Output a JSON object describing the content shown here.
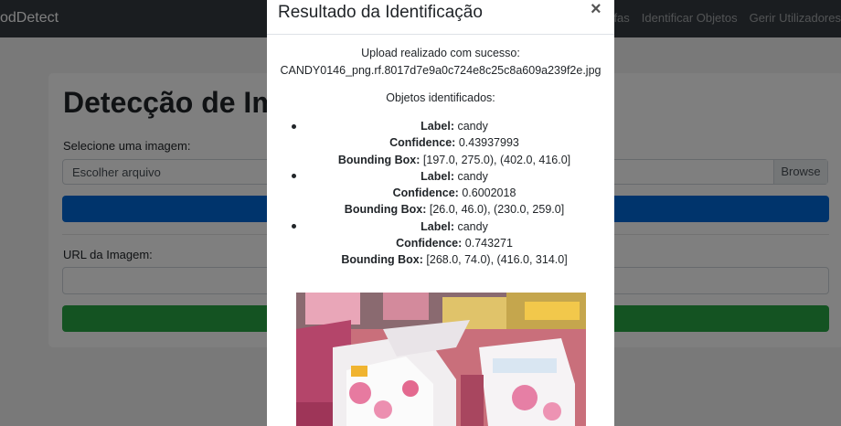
{
  "navbar": {
    "brand": "odDetect",
    "links": [
      "arefas",
      "Identificar Objetos",
      "Gerir Utilizadores"
    ]
  },
  "page": {
    "title": "Detecção de Ima",
    "select_label": "Selecione uma imagem:",
    "file_placeholder": "Escolher arquivo",
    "browse_label": "Browse",
    "url_label": "URL da Imagem:"
  },
  "modal": {
    "title": "Resultado da Identificação",
    "close_label": "×",
    "upload_message": "Upload realizado com sucesso:",
    "filename": "CANDY0146_png.rf.8017d7e9a0c724e8c25c8a609a239f2e.jpg",
    "objects_heading": "Objetos identificados:",
    "field_labels": {
      "label": "Label:",
      "confidence": "Confidence:",
      "bbox": "Bounding Box:"
    },
    "detections": [
      {
        "label": "candy",
        "confidence": "0.43937993",
        "bbox": "[197.0, 275.0), (402.0, 416.0]"
      },
      {
        "label": "candy",
        "confidence": "0.6002018",
        "bbox": "[26.0, 46.0), (230.0, 259.0]"
      },
      {
        "label": "candy",
        "confidence": "0.743271",
        "bbox": "[268.0, 74.0), (416.0, 314.0]"
      }
    ]
  },
  "colors": {
    "navbar_bg": "#343a40",
    "primary": "#0069d9",
    "success": "#28a745",
    "backdrop": "rgba(0,0,0,0.5)"
  },
  "icons": {
    "close": "close-icon",
    "bullet": "bullet-icon"
  }
}
